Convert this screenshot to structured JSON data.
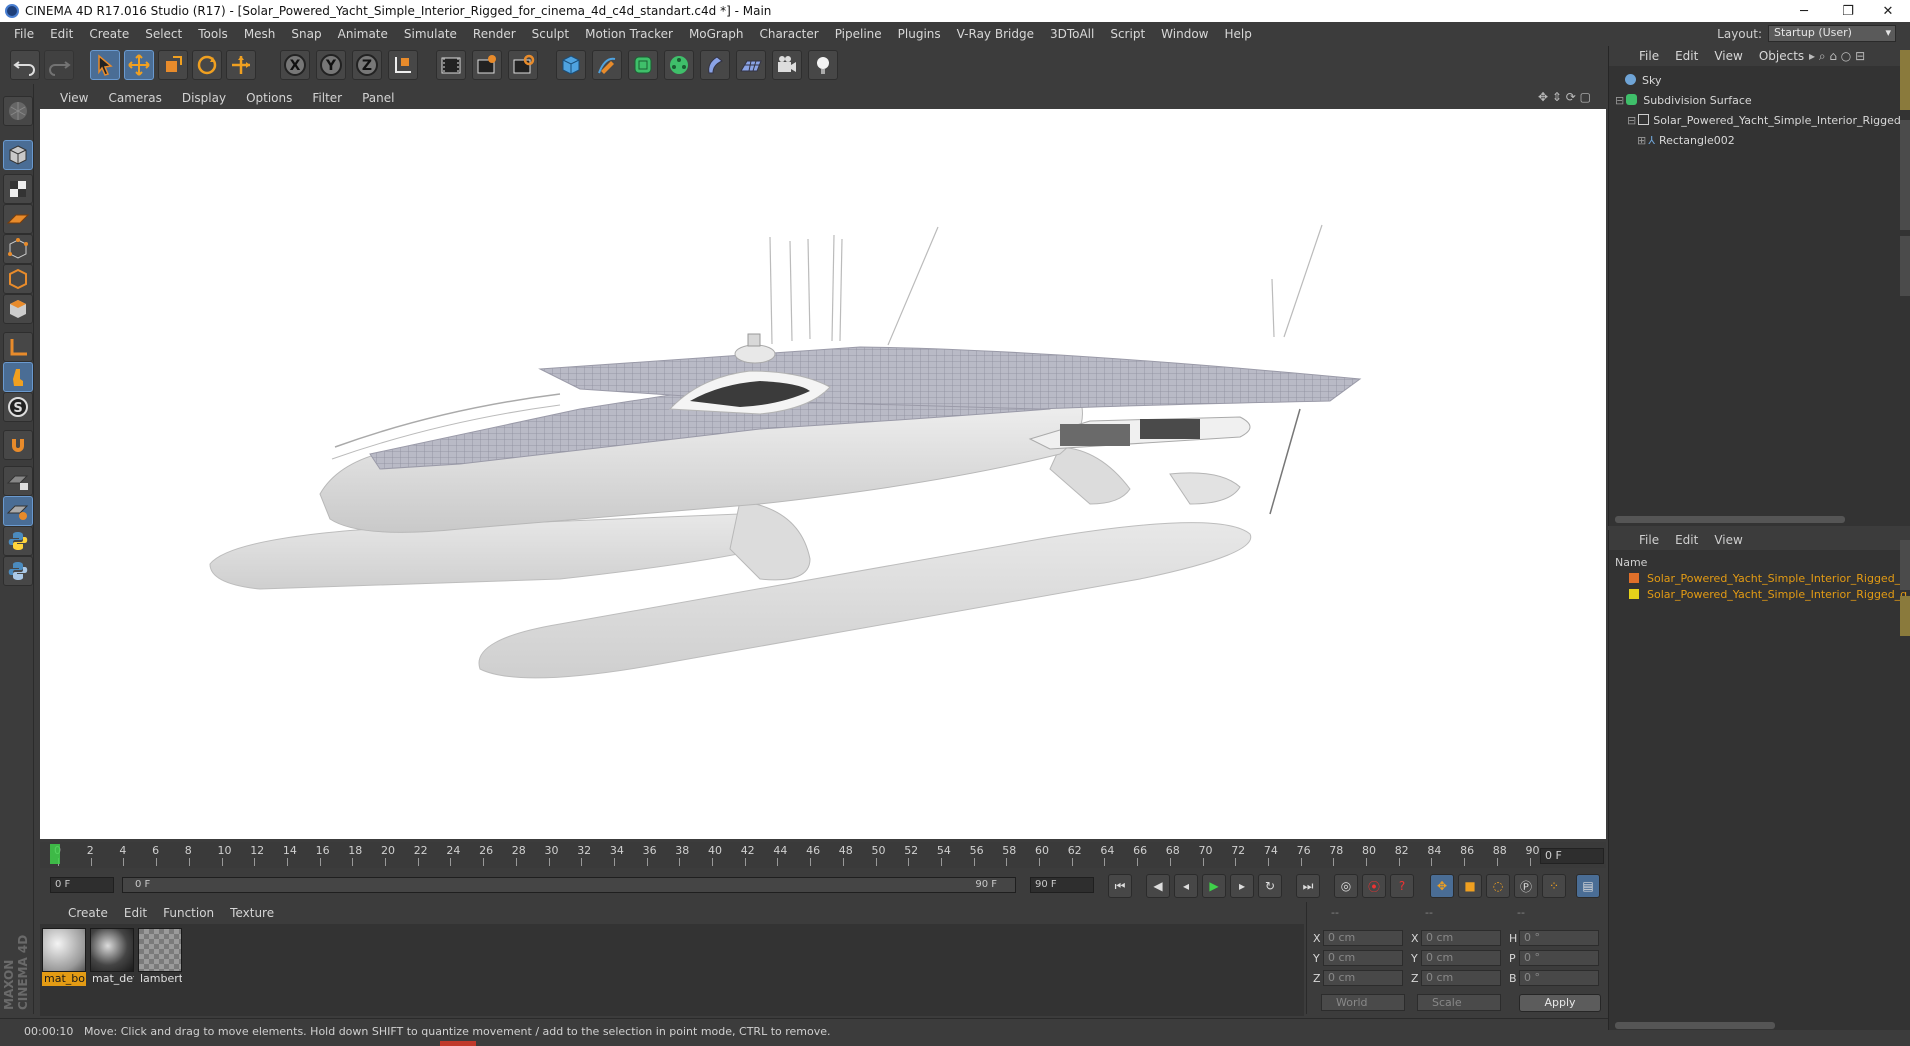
{
  "window": {
    "title": "CINEMA 4D R17.016 Studio (R17) - [Solar_Powered_Yacht_Simple_Interior_Rigged_for_cinema_4d_c4d_standart.c4d *] - Main"
  },
  "menubar": {
    "items": [
      "File",
      "Edit",
      "Create",
      "Select",
      "Tools",
      "Mesh",
      "Snap",
      "Animate",
      "Simulate",
      "Render",
      "Sculpt",
      "Motion Tracker",
      "MoGraph",
      "Character",
      "Pipeline",
      "Plugins",
      "V-Ray Bridge",
      "3DToAll",
      "Script",
      "Window",
      "Help"
    ],
    "layout_label": "Layout:",
    "layout_value": "Startup (User)"
  },
  "toolbar": {
    "icons": [
      "undo-icon",
      "redo-icon",
      "live-selection-icon",
      "move-icon",
      "scale-icon",
      "rotate-icon",
      "move-axis-icon",
      "x-axis-icon",
      "y-axis-icon",
      "z-axis-icon",
      "coordinate-system-icon",
      "render-view-icon",
      "render-picture-viewer-icon",
      "render-settings-icon",
      "cube-icon",
      "pen-icon",
      "subdivision-icon",
      "cloner-icon",
      "deformer-icon",
      "floor-icon",
      "camera-icon",
      "light-icon"
    ]
  },
  "viewport": {
    "menu": [
      "View",
      "Cameras",
      "Display",
      "Options",
      "Filter",
      "Panel"
    ]
  },
  "timeline": {
    "ticks": [
      "0",
      "2",
      "4",
      "6",
      "8",
      "10",
      "12",
      "14",
      "16",
      "18",
      "20",
      "22",
      "24",
      "26",
      "28",
      "30",
      "32",
      "34",
      "36",
      "38",
      "40",
      "42",
      "44",
      "46",
      "48",
      "50",
      "52",
      "54",
      "56",
      "58",
      "60",
      "62",
      "64",
      "66",
      "68",
      "70",
      "72",
      "74",
      "76",
      "78",
      "80",
      "82",
      "84",
      "86",
      "88",
      "90"
    ],
    "current_frame": "0 F",
    "start_frame": "0 F",
    "range_start": "0 F",
    "range_end": "90 F",
    "end_frame": "90 F"
  },
  "material_manager": {
    "menu": [
      "Create",
      "Edit",
      "Function",
      "Texture"
    ],
    "materials": [
      {
        "label": "mat_bo",
        "active": true
      },
      {
        "label": "mat_det",
        "active": false
      },
      {
        "label": "lambert",
        "active": false
      }
    ]
  },
  "coordinates": {
    "header": [
      "--",
      "--",
      "--"
    ],
    "rows": [
      {
        "l1": "X",
        "v1": "0 cm",
        "l2": "X",
        "v2": "0 cm",
        "l3": "H",
        "v3": "0 °"
      },
      {
        "l1": "Y",
        "v1": "0 cm",
        "l2": "Y",
        "v2": "0 cm",
        "l3": "P",
        "v3": "0 °"
      },
      {
        "l1": "Z",
        "v1": "0 cm",
        "l2": "Z",
        "v2": "0 cm",
        "l3": "B",
        "v3": "0 °"
      }
    ],
    "mode": "World",
    "scale_mode": "Scale",
    "apply_label": "Apply"
  },
  "status": {
    "time": "00:00:10",
    "message": "Move: Click and drag to move elements. Hold down SHIFT to quantize movement / add to the selection in point mode, CTRL to remove."
  },
  "object_manager": {
    "menu": [
      "File",
      "Edit",
      "View",
      "Objects"
    ],
    "objects": [
      {
        "name": "Sky"
      },
      {
        "name": "Subdivision Surface"
      },
      {
        "name": "Solar_Powered_Yacht_Simple_Interior_Rigged_"
      },
      {
        "name": "Rectangle002"
      }
    ]
  },
  "layers_panel": {
    "menu": [
      "File",
      "Edit",
      "View"
    ],
    "column_header": "Name",
    "rows": [
      {
        "name": "Solar_Powered_Yacht_Simple_Interior_Rigged_h",
        "color": "#e0702a"
      },
      {
        "name": "Solar_Powered_Yacht_Simple_Interior_Rigged_g",
        "color": "#e6d21a"
      }
    ]
  },
  "branding": {
    "maxon": "MAXON",
    "product": "CINEMA 4D"
  },
  "colors": {
    "accent": "#4a6d95",
    "highlight": "#e39b14",
    "panel": "#3c3c3c"
  }
}
